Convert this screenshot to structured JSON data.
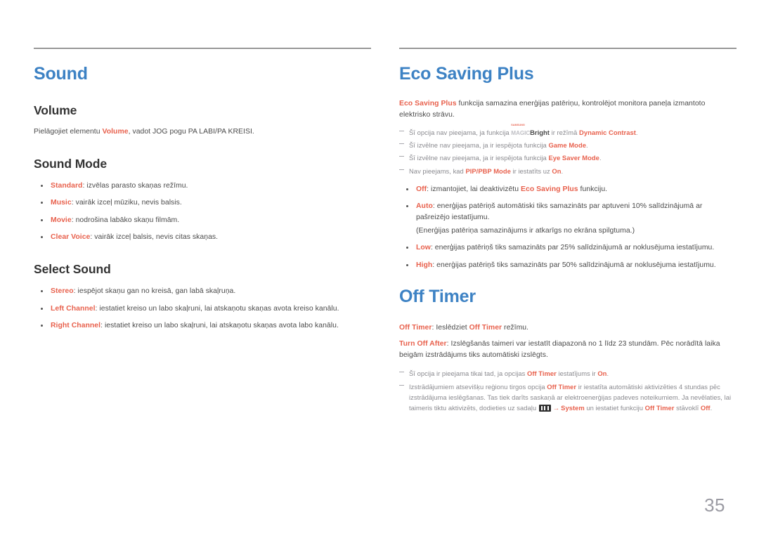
{
  "page": {
    "number": "35",
    "accent_color": "#e8614d",
    "heading_color": "#3d82c4",
    "body_color": "#4a4a4a",
    "note_color": "#8a8a8f"
  },
  "left_column": {
    "chapter_title": "Sound",
    "sections": [
      {
        "title": "Volume",
        "paragraph_prefix": "Pielāgojiet elementu ",
        "paragraph_term": "Volume",
        "paragraph_suffix": ", vadot JOG pogu PA LABI/PA KREISI."
      },
      {
        "title": "Sound Mode",
        "bullets": [
          {
            "term": "Standard",
            "text": ": izvēlas parasto skaņas režīmu."
          },
          {
            "term": "Music",
            "text": ": vairāk izceļ mūziku, nevis balsis."
          },
          {
            "term": "Movie",
            "text": ": nodrošina labāko skaņu filmām."
          },
          {
            "term": "Clear Voice",
            "text": ": vairāk izceļ balsis, nevis citas skaņas."
          }
        ]
      },
      {
        "title": "Select Sound",
        "bullets": [
          {
            "term": "Stereo",
            "text": ": iespējot skaņu gan no kreisā, gan labā skaļruņa."
          },
          {
            "term": "Left Channel",
            "text": ": iestatiet kreiso un labo skaļruni, lai atskaņotu skaņas avota kreiso kanālu."
          },
          {
            "term": "Right Channel",
            "text": ": iestatiet kreiso un labo skaļruni, lai atskaņotu skaņas avota labo kanālu."
          }
        ]
      }
    ]
  },
  "right_column": {
    "eco": {
      "chapter_title": "Eco Saving Plus",
      "intro_term": "Eco Saving Plus",
      "intro_text": " funkcija samazina enerģijas patēriņu, kontrolējot monitora paneļa izmantoto elektrisko strāvu.",
      "notes": [
        {
          "pre": "Šī opcija nav pieejama, ja funkcija ",
          "logo": {
            "samsung": "SAMSUNG",
            "magic": "MAGIC",
            "bright": "Bright"
          },
          "mid": " ir režīmā ",
          "term": "Dynamic Contrast",
          "post": "."
        },
        {
          "pre": "Šī izvēlne nav pieejama, ja ir iespējota funkcija ",
          "term": "Game Mode",
          "post": "."
        },
        {
          "pre": "Šī izvēlne nav pieejama, ja ir iespējota funkcija ",
          "term": "Eye Saver Mode",
          "post": "."
        },
        {
          "pre": "Nav pieejams, kad ",
          "term": "PIP/PBP Mode",
          "mid2": " ir iestatīts uz ",
          "term2": "On",
          "post": "."
        }
      ],
      "bullets": [
        {
          "term": "Off",
          "text": ": izmantojiet, lai deaktivizētu ",
          "term2": "Eco Saving Plus",
          "text2": " funkciju."
        },
        {
          "term": "Auto",
          "text": ": enerģijas patēriņš automātiski tiks samazināts par aptuveni 10% salīdzinājumā ar pašreizējo iestatījumu.",
          "sub": "(Enerģijas patēriņa samazinājums ir atkarīgs no ekrāna spilgtuma.)"
        },
        {
          "term": "Low",
          "text": ": enerģijas patēriņš tiks samazināts par 25% salīdzinājumā ar noklusējuma iestatījumu."
        },
        {
          "term": "High",
          "text": ": enerģijas patēriņš tiks samazināts par 50% salīdzinājumā ar noklusējuma iestatījumu."
        }
      ]
    },
    "off_timer": {
      "chapter_title": "Off Timer",
      "paragraphs": [
        {
          "term": "Off Timer",
          "text": ": Ieslēdziet ",
          "term2": "Off Timer",
          "text2": " režīmu."
        },
        {
          "term": "Turn Off After",
          "text": ": Izslēgšanās taimeri var iestatīt diapazonā no 1 līdz 23 stundām. Pēc norādītā laika beigām izstrādājums tiks automātiski izslēgts."
        }
      ],
      "notes": [
        {
          "pre": "Šī opcija ir pieejama tikai tad, ja opcijas ",
          "term": "Off Timer",
          "mid": " iestatījums ir ",
          "term2": "On",
          "post": "."
        },
        {
          "pre": "Izstrādājumiem atsevišķu reģionu tirgos opcija ",
          "term": "Off Timer",
          "mid": " ir iestatīta automātiski aktivizēties 4 stundas pēc izstrādājuma ieslēgšanas. Tas tiek darīts saskaņā ar elektroenerģijas padeves noteikumiem. Ja nevēlaties, lai taimeris tiktu aktivizēts, dodieties uz sadaļu ",
          "icon": "menu-icon",
          "arrow": "→",
          "term2": "System",
          "mid2": " un iestatiet funkciju ",
          "term3": "Off Timer",
          "mid3": " stāvoklī ",
          "term4": "Off",
          "post": "."
        }
      ]
    }
  }
}
